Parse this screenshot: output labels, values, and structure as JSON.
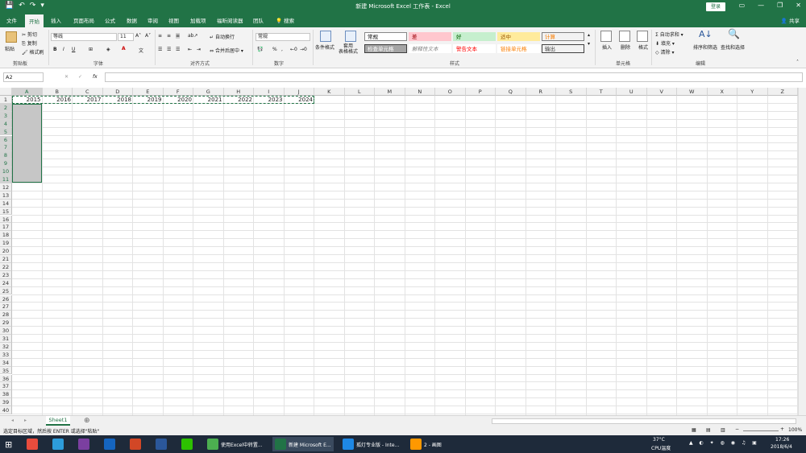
{
  "titlebar": {
    "title": "新建 Microsoft Excel 工作表 - Excel",
    "login": "登录"
  },
  "tabs": [
    "文件",
    "开始",
    "插入",
    "页面布局",
    "公式",
    "数据",
    "审阅",
    "视图",
    "加载项",
    "福昕阅读器",
    "团队",
    "搜索"
  ],
  "active_tab": "开始",
  "share": "共享",
  "ribbon": {
    "clipboard": {
      "paste": "粘贴",
      "cut": "剪切",
      "copy": "复制",
      "format_painter": "格式刷",
      "label": "剪贴板"
    },
    "font": {
      "name": "等线",
      "size": "11",
      "label": "字体"
    },
    "alignment": {
      "wrap": "自动换行",
      "merge": "合并后居中",
      "label": "对齐方式"
    },
    "number": {
      "format": "常规",
      "label": "数字"
    },
    "styles": {
      "cond_format": "条件格式",
      "table_format": "套用\n表格格式",
      "cells": [
        {
          "text": "常规",
          "bg": "#ffffff",
          "color": "#000000",
          "border": "#888888"
        },
        {
          "text": "差",
          "bg": "#ffc7ce",
          "color": "#9c0006",
          "border": "#ffc7ce"
        },
        {
          "text": "好",
          "bg": "#c6efce",
          "color": "#006100",
          "border": "#c6efce"
        },
        {
          "text": "适中",
          "bg": "#ffeb9c",
          "color": "#9c5700",
          "border": "#ffeb9c"
        },
        {
          "text": "计算",
          "bg": "#f2f2f2",
          "color": "#fa7d00",
          "border": "#7f7f7f"
        },
        {
          "text": "检查单元格",
          "bg": "#a5a5a5",
          "color": "#ffffff",
          "border": "#3f3f3f"
        },
        {
          "text": "解释性文本",
          "bg": "#ffffff",
          "color": "#7f7f7f",
          "border": "#ffffff"
        },
        {
          "text": "警告文本",
          "bg": "#ffffff",
          "color": "#ff0000",
          "border": "#ffffff"
        },
        {
          "text": "链接单元格",
          "bg": "#ffffff",
          "color": "#fa7d00",
          "border": "#ffffff"
        },
        {
          "text": "输出",
          "bg": "#f2f2f2",
          "color": "#3f3f3f",
          "border": "#3f3f3f"
        }
      ],
      "label": "样式"
    },
    "cells_group": {
      "insert": "插入",
      "delete": "删除",
      "format": "格式",
      "label": "单元格"
    },
    "editing": {
      "autosum": "自动求和",
      "fill": "填充",
      "clear": "清除",
      "sort": "排序和筛选",
      "find": "查找和选择",
      "label": "编辑"
    }
  },
  "formula_bar": {
    "name_box": "A2",
    "fx": "fx",
    "value": ""
  },
  "columns": [
    "A",
    "B",
    "C",
    "D",
    "E",
    "F",
    "G",
    "H",
    "I",
    "J",
    "K",
    "L",
    "M",
    "N",
    "O",
    "P",
    "Q",
    "R",
    "S",
    "T",
    "U",
    "V",
    "W",
    "X",
    "Y",
    "Z"
  ],
  "rows": [
    "1",
    "2",
    "3",
    "4",
    "5",
    "6",
    "7",
    "8",
    "9",
    "10",
    "11",
    "12",
    "13",
    "14",
    "15",
    "16",
    "17",
    "18",
    "19",
    "20",
    "21",
    "22",
    "23",
    "24",
    "25",
    "26",
    "27",
    "28",
    "29",
    "30",
    "31",
    "32",
    "33",
    "34",
    "35",
    "36",
    "37",
    "38",
    "39",
    "40"
  ],
  "row1_values": [
    "2015",
    "2016",
    "2017",
    "2018",
    "2019",
    "2020",
    "2021",
    "2022",
    "2023",
    "2024"
  ],
  "sheet_tab": "Sheet1",
  "status": {
    "message": "选定目标区域，然后按 ENTER 或选择\"粘贴\"",
    "zoom": "100%"
  },
  "taskbar": {
    "items": [
      {
        "label": "",
        "color": "#e84c3d"
      },
      {
        "label": "",
        "color": "#2d9cdb"
      },
      {
        "label": "",
        "color": "#7b3fa0"
      },
      {
        "label": "",
        "color": "#1565c0"
      },
      {
        "label": "",
        "color": "#d24726"
      },
      {
        "label": "",
        "color": "#2b579a"
      },
      {
        "label": "",
        "color": "#2dc100"
      },
      {
        "label": "使用Excel中转置...",
        "color": "#4caf50"
      },
      {
        "label": "新建 Microsoft E...",
        "color": "#217346"
      },
      {
        "label": "孤灯专业版 - Inte...",
        "color": "#1e88e5"
      },
      {
        "label": "2 - 画图",
        "color": "#ff9800"
      }
    ],
    "temp": "37°C",
    "cpu": "CPU温度",
    "time": "17:26",
    "date": "2018/6/4"
  },
  "colors": {
    "excel_green": "#217346"
  }
}
